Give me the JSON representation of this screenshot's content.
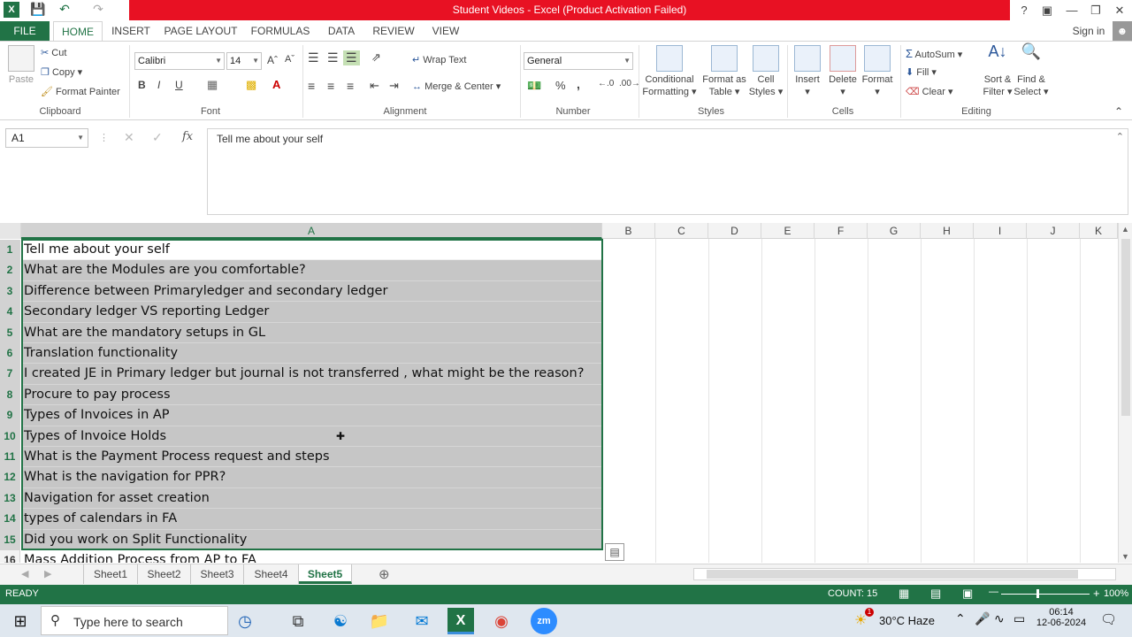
{
  "window": {
    "title": "Student Videos -  Excel (Product Activation Failed)",
    "help": "?",
    "signin": "Sign in"
  },
  "ribbon_tabs": [
    "FILE",
    "HOME",
    "INSERT",
    "PAGE LAYOUT",
    "FORMULAS",
    "DATA",
    "REVIEW",
    "VIEW"
  ],
  "clipboard": {
    "paste": "Paste",
    "cut": "Cut",
    "copy": "Copy",
    "format_painter": "Format Painter",
    "label": "Clipboard"
  },
  "font": {
    "name": "Calibri",
    "size": "14",
    "label": "Font",
    "bold": "B",
    "italic": "I",
    "underline": "U"
  },
  "alignment": {
    "wrap": "Wrap Text",
    "merge": "Merge & Center",
    "label": "Alignment"
  },
  "number": {
    "format": "General",
    "label": "Number",
    "percent": "%",
    "comma": ","
  },
  "styles": {
    "conditional": "Conditional",
    "conditional2": "Formatting",
    "format_as": "Format as",
    "format_as2": "Table",
    "cell": "Cell",
    "cell2": "Styles",
    "label": "Styles"
  },
  "cells": {
    "insert": "Insert",
    "delete": "Delete",
    "format": "Format",
    "label": "Cells"
  },
  "editing": {
    "autosum": "AutoSum",
    "fill": "Fill",
    "clear": "Clear",
    "sort": "Sort &",
    "sort2": "Filter",
    "find": "Find &",
    "find2": "Select",
    "label": "Editing"
  },
  "formula_bar": {
    "namebox": "A1",
    "fx": "fx",
    "content": "Tell me about your self"
  },
  "columns": [
    "A",
    "B",
    "C",
    "D",
    "E",
    "F",
    "G",
    "H",
    "I",
    "J",
    "K"
  ],
  "rows": [
    {
      "num": "1",
      "text": "Tell me about your self"
    },
    {
      "num": "2",
      "text": "What are the Modules are you comfortable?"
    },
    {
      "num": "3",
      "text": "Difference between Primaryledger and secondary ledger"
    },
    {
      "num": "4",
      "text": "Secondary ledger VS reporting Ledger"
    },
    {
      "num": "5",
      "text": "What are the mandatory setups in GL"
    },
    {
      "num": "6",
      "text": "Translation functionality"
    },
    {
      "num": "7",
      "text": "I created JE in Primary ledger but journal is not transferred  , what might be the reason?"
    },
    {
      "num": "8",
      "text": "Procure to pay process"
    },
    {
      "num": "9",
      "text": "Types of Invoices in AP"
    },
    {
      "num": "10",
      "text": "Types of Invoice Holds"
    },
    {
      "num": "11",
      "text": "What is the Payment Process request and steps"
    },
    {
      "num": "12",
      "text": "What is the navigation for PPR?"
    },
    {
      "num": "13",
      "text": "Navigation for asset creation"
    },
    {
      "num": "14",
      "text": "types of calendars in FA"
    },
    {
      "num": "15",
      "text": "Did you work on Split Functionality"
    },
    {
      "num": "16",
      "text": "Mass Addition Process from AP to FA"
    }
  ],
  "sheets": [
    "Sheet1",
    "Sheet2",
    "Sheet3",
    "Sheet4",
    "Sheet5"
  ],
  "active_sheet": "Sheet5",
  "status": {
    "mode": "READY",
    "count": "COUNT: 15",
    "zoom": "100%"
  },
  "taskbar": {
    "search": "Type here to search",
    "weather": "30°C  Haze",
    "time": "06:14",
    "date": "12-06-2024",
    "notif": "1"
  },
  "colors": {
    "excel_green": "#217346",
    "title_red": "#e81123",
    "selection": "#c6c6c6"
  }
}
